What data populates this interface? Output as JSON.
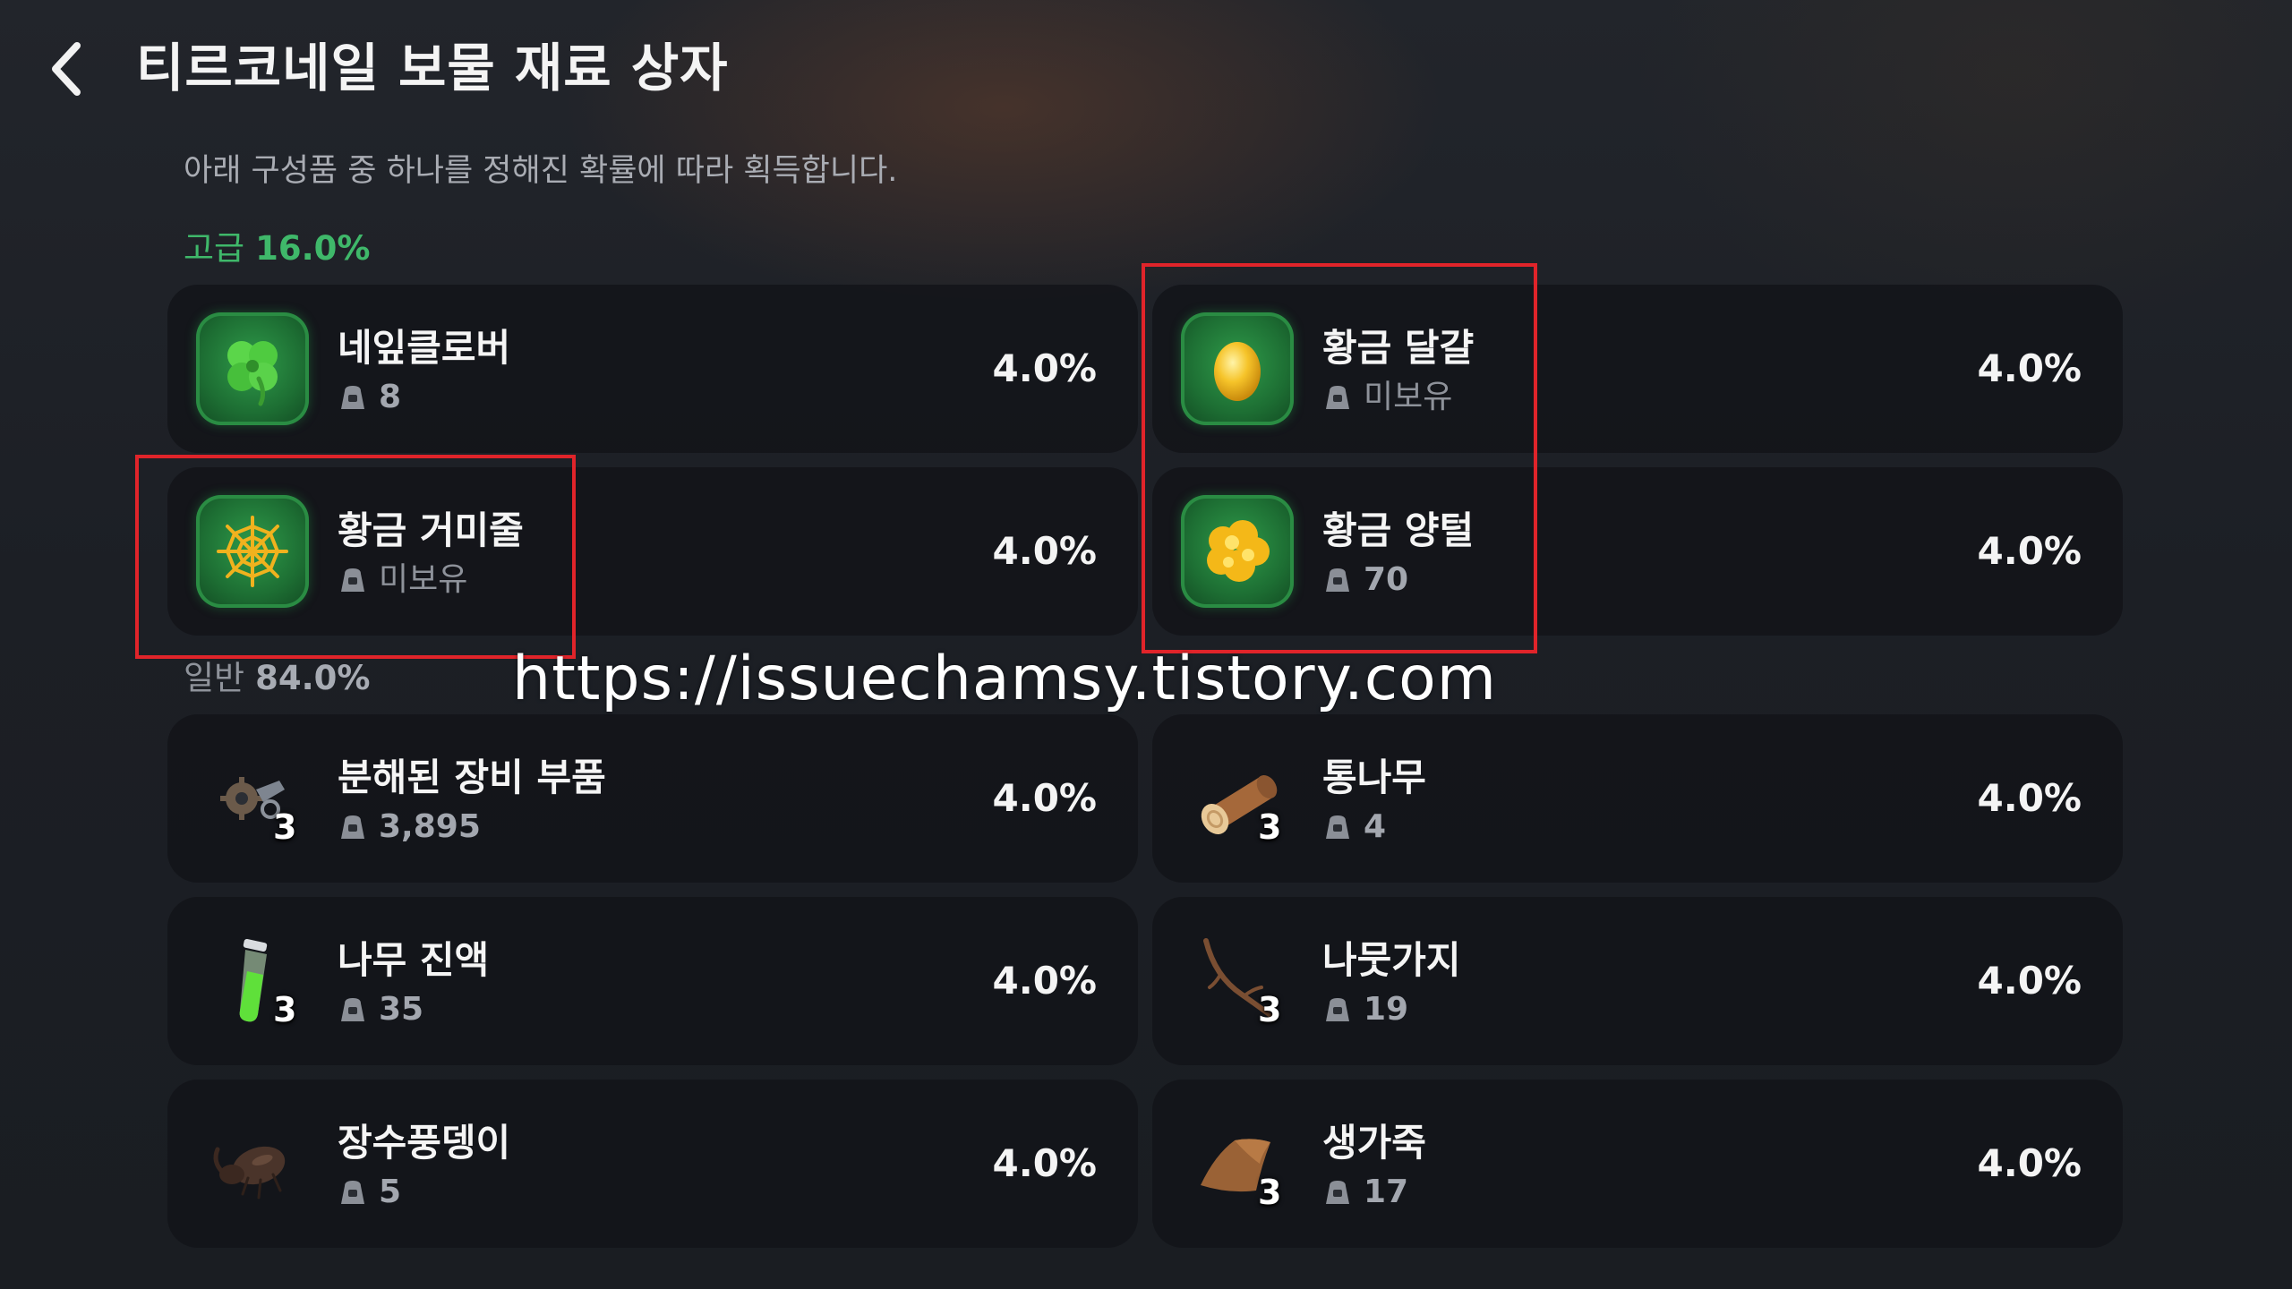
{
  "header": {
    "title": "티르코네일 보물 재료 상자",
    "subtitle": "아래 구성품 중 하나를 정해진 확률에 따라 획득합니다."
  },
  "sections": {
    "high": {
      "name": "고급",
      "percent": "16.0%"
    },
    "normal": {
      "name": "일반",
      "percent": "84.0%"
    }
  },
  "items": [
    {
      "name": "네잎클로버",
      "owned": "8",
      "chance": "4.0%",
      "icon": "four-leaf-clover-icon",
      "tier": "high"
    },
    {
      "name": "황금 달걀",
      "owned": "미보유",
      "chance": "4.0%",
      "icon": "golden-egg-icon",
      "tier": "high"
    },
    {
      "name": "황금 거미줄",
      "owned": "미보유",
      "chance": "4.0%",
      "icon": "golden-spiderweb-icon",
      "tier": "high"
    },
    {
      "name": "황금 양털",
      "owned": "70",
      "chance": "4.0%",
      "icon": "golden-wool-icon",
      "tier": "high"
    },
    {
      "name": "분해된 장비 부품",
      "owned": "3,895",
      "chance": "4.0%",
      "quantity": "3",
      "icon": "gear-parts-icon",
      "tier": "normal"
    },
    {
      "name": "통나무",
      "owned": "4",
      "chance": "4.0%",
      "quantity": "3",
      "icon": "log-icon",
      "tier": "normal"
    },
    {
      "name": "나무 진액",
      "owned": "35",
      "chance": "4.0%",
      "quantity": "3",
      "icon": "sap-vial-icon",
      "tier": "normal"
    },
    {
      "name": "나뭇가지",
      "owned": "19",
      "chance": "4.0%",
      "quantity": "3",
      "icon": "twig-icon",
      "tier": "normal"
    },
    {
      "name": "장수풍뎅이",
      "owned": "5",
      "chance": "4.0%",
      "icon": "beetle-icon",
      "tier": "normal"
    },
    {
      "name": "생가죽",
      "owned": "17",
      "chance": "4.0%",
      "quantity": "3",
      "icon": "rawhide-icon",
      "tier": "normal"
    }
  ],
  "watermark": "https://issuechamsy.tistory.com",
  "colors": {
    "high_tier_green": "#3fb86a",
    "highlight_red": "#e0242a",
    "card_bg": "#121419"
  }
}
